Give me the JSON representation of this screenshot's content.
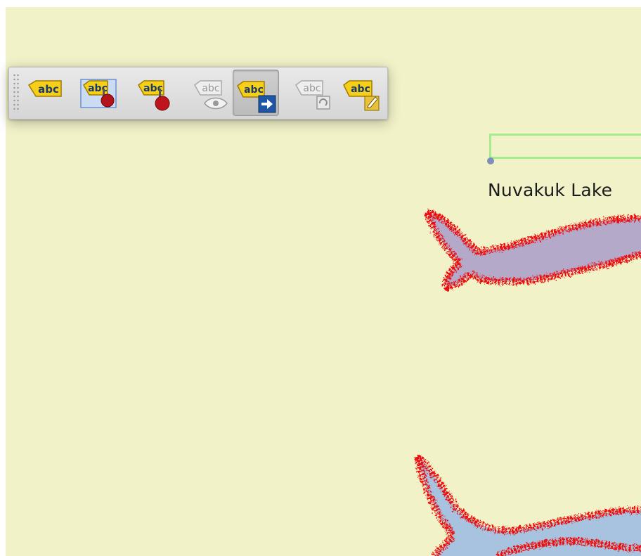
{
  "map": {
    "background_color": "#f1f2c8",
    "lake_fill": "#b5a9c9",
    "lake_fill_lower": "#a8c3df",
    "lake_outline": "#ee1111",
    "label_text": "Nuvakuk Lake",
    "label_box_color": "#a6ec8c"
  },
  "label_toolbar": {
    "tools": [
      {
        "name": "layer-labeling-icon",
        "icon_text": "abc",
        "state": "enabled"
      },
      {
        "name": "pin-labels-icon",
        "icon_text": "abc",
        "state": "enabled"
      },
      {
        "name": "pin-labels-selected-icon",
        "icon_text": "abc",
        "state": "enabled"
      },
      {
        "name": "show-hide-labels-icon",
        "icon_text": "abc",
        "state": "disabled"
      },
      {
        "name": "move-label-icon",
        "icon_text": "abc",
        "state": "active"
      },
      {
        "name": "rotate-label-icon",
        "icon_text": "abc",
        "state": "disabled"
      },
      {
        "name": "change-label-icon",
        "icon_text": "abc",
        "state": "enabled"
      }
    ]
  }
}
